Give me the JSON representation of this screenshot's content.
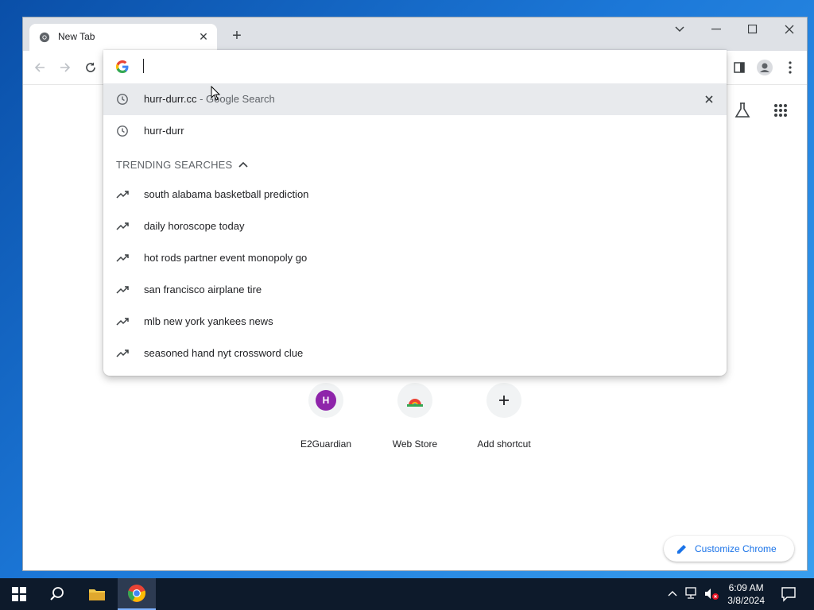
{
  "browser": {
    "tab_title": "New Tab",
    "tab_close": "✕",
    "new_tab": "+"
  },
  "omnibox": {
    "input_value": "",
    "suggestions": [
      {
        "text": "hurr-durr.cc",
        "sub": " - Google Search",
        "icon": "history-icon"
      },
      {
        "text": "hurr-durr",
        "sub": "",
        "icon": "history-icon"
      }
    ],
    "trending_header": "TRENDING SEARCHES",
    "trending": [
      "south alabama basketball prediction",
      "daily horoscope today",
      "hot rods partner event monopoly go",
      "san francisco airplane tire",
      "mlb new york yankees news",
      "seasoned hand nyt crossword clue"
    ]
  },
  "ntp": {
    "shortcuts": [
      {
        "label": "E2Guardian",
        "letter": "H",
        "color": "#8e24aa"
      },
      {
        "label": "Web Store",
        "icon": "chrome-webstore-icon"
      },
      {
        "label": "Add shortcut",
        "icon": "plus-icon"
      }
    ],
    "customize_label": "Customize Chrome"
  },
  "taskbar": {
    "time": "6:09 AM",
    "date": "3/8/2024"
  },
  "colors": {
    "accent": "#1a73e8",
    "taskbar": "#0d1a2b",
    "desktop": "#1c78d8"
  }
}
